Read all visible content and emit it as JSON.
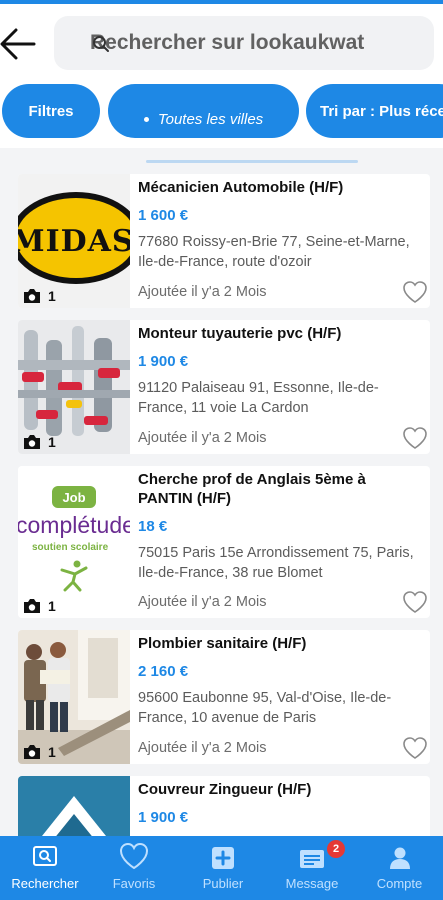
{
  "search": {
    "placeholder": "Rechercher sur lookaukwat"
  },
  "filters": {
    "filtres_label": "Filtres",
    "villes_label": "Toutes les villes",
    "tri_label": "Tri par : Plus réce"
  },
  "listings": [
    {
      "title": "Mécanicien Automobile (H/F)",
      "price": "1 600 €",
      "address": "77680 Roissy-en-Brie 77, Seine-et-Marne, Ile-de-France, route d'ozoir",
      "added": "Ajoutée il y'a 2 Mois",
      "photo_count": "1",
      "thumb_text": "MIDAS"
    },
    {
      "title": "Monteur tuyauterie pvc (H/F)",
      "price": "1 900 €",
      "address": "91120 Palaiseau 91, Essonne, Ile-de-France, 11 voie La Cardon",
      "added": "Ajoutée il y'a 2 Mois",
      "photo_count": "1"
    },
    {
      "title": "Cherche prof de Anglais 5ème à PANTIN (H/F)",
      "price": "18 €",
      "address": "75015 Paris 15e Arrondissement 75, Paris, Ile-de-France, 38 rue Blomet",
      "added": "Ajoutée il y'a 2 Mois",
      "photo_count": "1",
      "thumb_badge": "Job",
      "thumb_brand": "complétude",
      "thumb_sub": "soutien scolaire"
    },
    {
      "title": "Plombier sanitaire (H/F)",
      "price": "2 160 €",
      "address": "95600 Eaubonne 95, Val-d'Oise, Ile-de-France, 10 avenue de Paris",
      "added": "Ajoutée il y'a 2 Mois",
      "photo_count": "1"
    },
    {
      "title": "Couvreur Zingueur (H/F)",
      "price": "1 900 €"
    }
  ],
  "nav": {
    "items": [
      {
        "label": "Rechercher"
      },
      {
        "label": "Favoris"
      },
      {
        "label": "Publier"
      },
      {
        "label": "Message",
        "badge": "2"
      },
      {
        "label": "Compte"
      }
    ]
  },
  "colors": {
    "accent": "#1e88e5",
    "badge": "#e53935",
    "card_bg": "#ffffff",
    "list_bg": "#f3f4f6"
  },
  "icons": [
    "back-arrow-icon",
    "search-icon",
    "camera-icon",
    "heart-icon",
    "search-nav-icon",
    "heart-nav-icon",
    "plus-square-icon",
    "message-icon",
    "user-icon"
  ]
}
